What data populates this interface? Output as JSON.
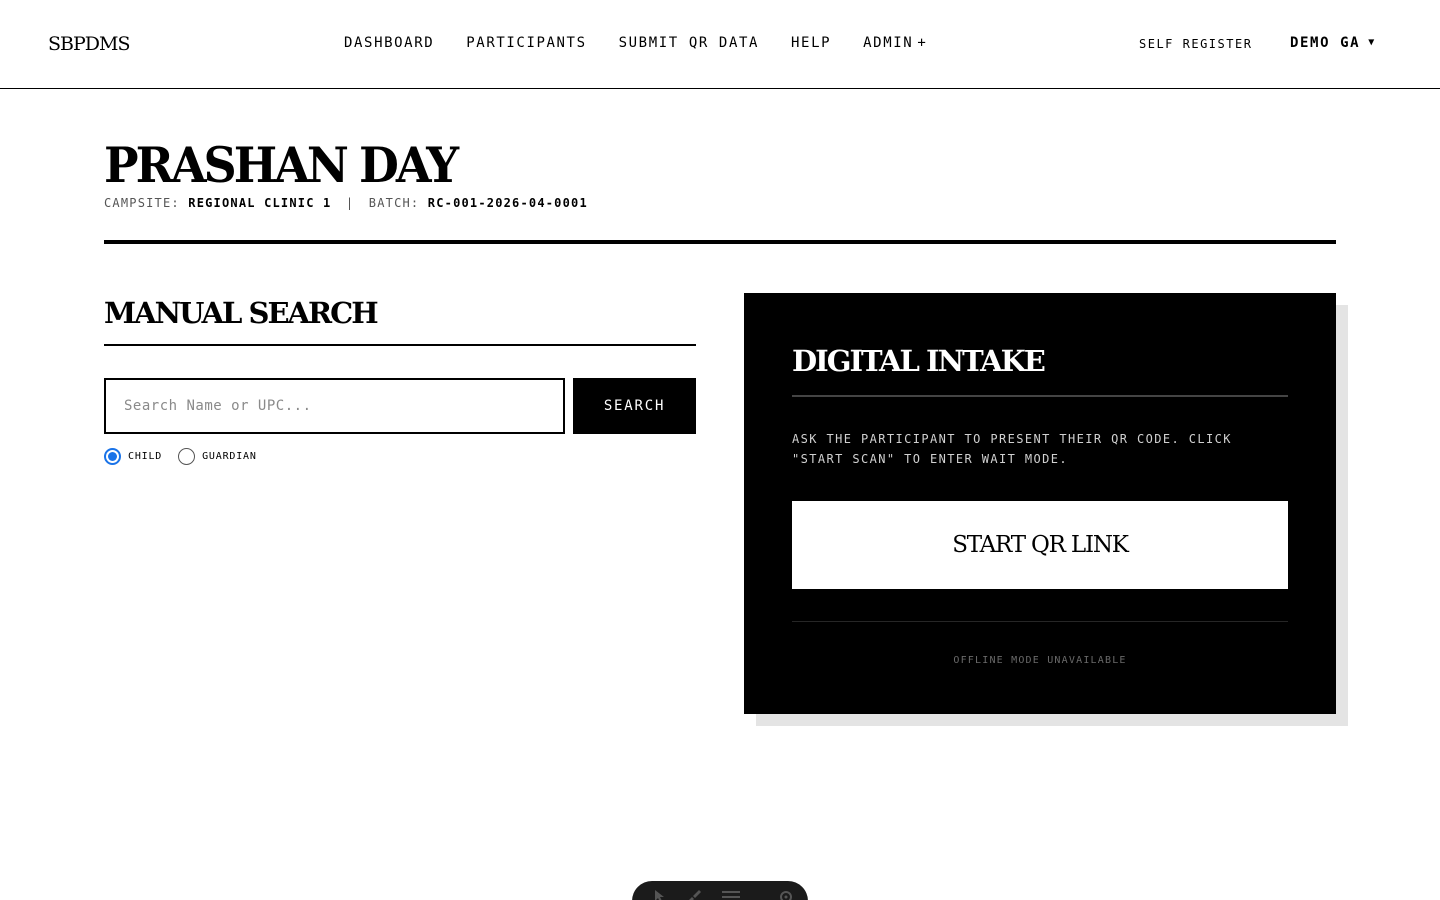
{
  "nav": {
    "logo": "SBPDMS",
    "items": [
      {
        "label": "DASHBOARD"
      },
      {
        "label": "PARTICIPANTS"
      },
      {
        "label": "SUBMIT QR DATA"
      },
      {
        "label": "HELP"
      },
      {
        "label": "ADMIN",
        "suffix": "+"
      }
    ],
    "self_register": "SELF REGISTER",
    "user": "DEMO GA",
    "user_caret": "▼"
  },
  "page": {
    "title": "PRASHAN DAY",
    "campsite_label": "CAMPSITE:",
    "campsite_value": "REGIONAL CLINIC 1",
    "separator": "|",
    "batch_label": "BATCH:",
    "batch_value": "RC-001-2026-04-0001"
  },
  "manual_search": {
    "title": "MANUAL SEARCH",
    "input_placeholder": "Search Name or UPC...",
    "input_value": "",
    "button_label": "SEARCH",
    "options": [
      {
        "label": "CHILD",
        "checked": true
      },
      {
        "label": "GUARDIAN",
        "checked": false
      }
    ]
  },
  "digital_intake": {
    "title": "DIGITAL INTAKE",
    "instructions": "ASK THE PARTICIPANT TO PRESENT THEIR QR CODE. CLICK \"START SCAN\" TO ENTER WAIT MODE.",
    "button_label": "START QR LINK",
    "offline_note": "OFFLINE MODE UNAVAILABLE"
  },
  "colors": {
    "ink": "#000000",
    "paper": "#ffffff",
    "accent_radio": "#1a73e8",
    "shadow": "#e4e4e4"
  },
  "icons": {
    "toolbar": [
      "cursor-icon",
      "paintbrush-icon",
      "menu-icon",
      "settings-icon"
    ]
  }
}
